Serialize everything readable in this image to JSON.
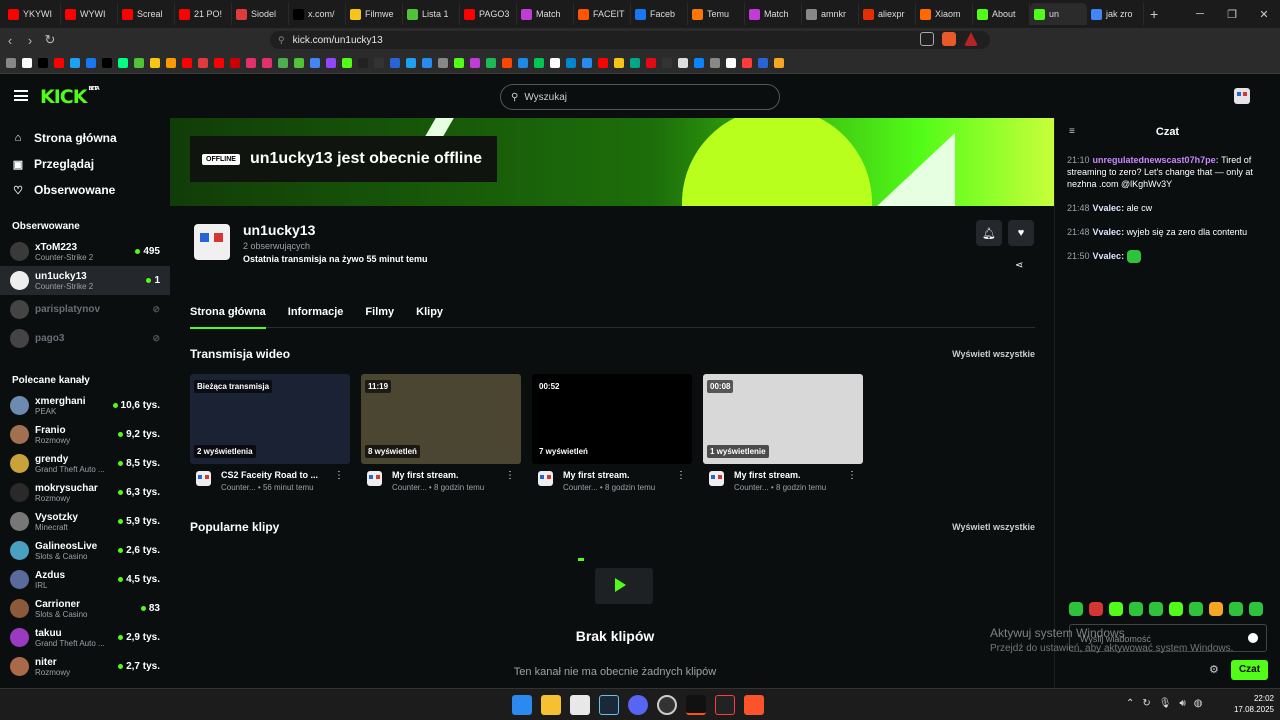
{
  "browser": {
    "tabs": [
      {
        "label": "YKYWI",
        "color": "#ff0000"
      },
      {
        "label": "WYWI",
        "color": "#ff0000"
      },
      {
        "label": "Screal",
        "color": "#ff0000"
      },
      {
        "label": "21 PO!",
        "color": "#ff0000"
      },
      {
        "label": "Siodel",
        "color": "#e03a3a"
      },
      {
        "label": "x.com/",
        "color": "#000000"
      },
      {
        "label": "Filmwe",
        "color": "#f5c518"
      },
      {
        "label": "Lista 1",
        "color": "#53c23b"
      },
      {
        "label": "PAGO3",
        "color": "#ff0000"
      },
      {
        "label": "Match",
        "color": "#c23bd6"
      },
      {
        "label": "FACEIT",
        "color": "#ff5500"
      },
      {
        "label": "Faceb",
        "color": "#1877f2"
      },
      {
        "label": "Temu",
        "color": "#fb7701"
      },
      {
        "label": "Match",
        "color": "#c23bd6"
      },
      {
        "label": "amnkr",
        "color": "#888888"
      },
      {
        "label": "aliexpr",
        "color": "#e62e04"
      },
      {
        "label": "Xiaom",
        "color": "#ff6900"
      },
      {
        "label": "About",
        "color": "#53fc18"
      },
      {
        "label": "un",
        "color": "#53fc18",
        "active": true
      },
      {
        "label": "jak zro",
        "color": "#4285f4"
      }
    ],
    "url": "kick.com/un1ucky13",
    "clock_time": "22:02",
    "clock_date": "17.08.2025"
  },
  "header": {
    "logo": "KICK",
    "logo_beta": "BETA",
    "search_placeholder": "Wyszukaj"
  },
  "sidebar": {
    "nav": [
      {
        "icon": "⌂",
        "label": "Strona główna"
      },
      {
        "icon": "▣",
        "label": "Przeglądaj"
      },
      {
        "icon": "♡",
        "label": "Obserwowane"
      }
    ],
    "followed_title": "Obserwowane",
    "followed": [
      {
        "name": "xToM223",
        "category": "Counter-Strike 2",
        "count": "495",
        "live": true,
        "avatar": "#3a3a3a"
      },
      {
        "name": "un1ucky13",
        "category": "Counter-Strike 2",
        "count": "1",
        "live": true,
        "selected": true,
        "avatar": "#eeeeee"
      },
      {
        "name": "parisplatynov",
        "category": "",
        "count": "⊘",
        "live": false,
        "avatar": "#444444"
      },
      {
        "name": "pago3",
        "category": "",
        "count": "⊘",
        "live": false,
        "avatar": "#444444"
      }
    ],
    "recommended_title": "Polecane kanały",
    "recommended": [
      {
        "name": "xmerghani",
        "category": "PEAK",
        "count": "10,6 tys.",
        "avatar": "#6d8ab0"
      },
      {
        "name": "Franio",
        "category": "Rozmowy",
        "count": "9,2 tys.",
        "avatar": "#a07050"
      },
      {
        "name": "grendy",
        "category": "Grand Theft Auto ...",
        "count": "8,5 tys.",
        "avatar": "#c9a23a"
      },
      {
        "name": "mokrysuchar",
        "category": "Rozmowy",
        "count": "6,3 tys.",
        "avatar": "#2a2a2a"
      },
      {
        "name": "Vysotzky",
        "category": "Minecraft",
        "count": "5,9 tys.",
        "avatar": "#777777"
      },
      {
        "name": "GalineosLive",
        "category": "Slots & Casino",
        "count": "2,6 tys.",
        "avatar": "#4aa0c0"
      },
      {
        "name": "Azdus",
        "category": "IRL",
        "count": "4,5 tys.",
        "avatar": "#5a6a9a"
      },
      {
        "name": "Carrioner",
        "category": "Slots & Casino",
        "count": "83",
        "avatar": "#8a5a3a"
      },
      {
        "name": "takuu",
        "category": "Grand Theft Auto ...",
        "count": "2,9 tys.",
        "avatar": "#9a3ac0"
      },
      {
        "name": "niter",
        "category": "Rozmowy",
        "count": "2,7 tys.",
        "avatar": "#aa6a4a"
      }
    ]
  },
  "channel": {
    "offline_badge": "OFFLINE",
    "offline_text": "un1ucky13 jest obecnie offline",
    "name": "un1ucky13",
    "followers": "2 obserwujących",
    "last_stream": "Ostatnia transmisja na żywo 55 minut temu",
    "tabs": [
      "Strona główna",
      "Informacje",
      "Filmy",
      "Klipy"
    ],
    "videos_title": "Transmisja wideo",
    "show_all": "Wyświetl wszystkie",
    "videos": [
      {
        "top": "Bieżąca transmisja",
        "views": "2 wyświetlenia",
        "title": "CS2 Faceity Road to ...",
        "category": "Counter...",
        "time": "56 minut temu",
        "bg": "#1a2233"
      },
      {
        "top": "11:19",
        "views": "8 wyświetleń",
        "title": "My first stream.",
        "category": "Counter...",
        "time": "8 godzin temu",
        "bg": "#4a4632"
      },
      {
        "top": "00:52",
        "views": "7 wyświetleń",
        "title": "My first stream.",
        "category": "Counter...",
        "time": "8 godzin temu",
        "bg": "#000000"
      },
      {
        "top": "00:08",
        "views": "1 wyświetlenie",
        "title": "My first stream.",
        "category": "Counter...",
        "time": "8 godzin temu",
        "bg": "#d8d8d8"
      }
    ],
    "clips_title": "Popularne klipy",
    "no_clips_title": "Brak klipów",
    "no_clips_sub": "Ten kanał nie ma obecnie żadnych klipów"
  },
  "chat": {
    "title": "Czat",
    "messages": [
      {
        "time": "21:10",
        "user": "unregulatednewscast07h7pe",
        "style": "u1",
        "text": "Tired of streaming to zero? Let's change that — only at nezhna .com @lKghWv3Y"
      },
      {
        "time": "21:48",
        "user": "Vvalec",
        "style": "u2",
        "text": "ale cw"
      },
      {
        "time": "21:48",
        "user": "Vvalec",
        "style": "u2",
        "text": "wyjeb się za zero dla contentu"
      },
      {
        "time": "21:50",
        "user": "Vvalec",
        "style": "u2",
        "text": ""
      }
    ],
    "input_placeholder": "Wyślij wiadomość",
    "send": "Czat",
    "watermark1": "Aktywuj system Windows",
    "watermark2": "Przejdź do ustawień, aby aktywować system Windows."
  }
}
